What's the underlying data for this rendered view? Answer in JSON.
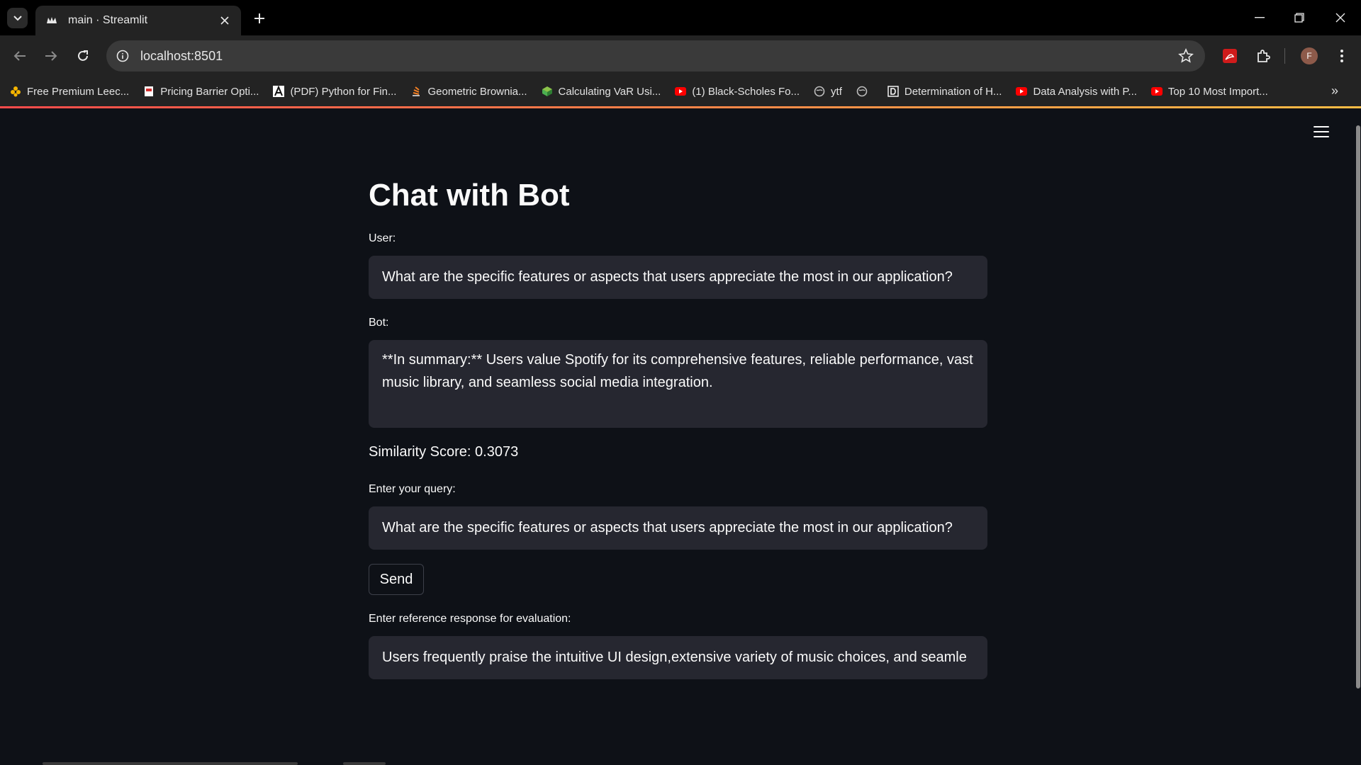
{
  "browser": {
    "tab_title": "main · Streamlit",
    "url": "localhost:8501",
    "avatar_letter": "F",
    "bookmarks": [
      {
        "label": "Free Premium Leec...",
        "icon": "flower-icon",
        "color": "#f4b400"
      },
      {
        "label": "Pricing Barrier Opti...",
        "icon": "document-icon",
        "color": "#d32f2f"
      },
      {
        "label": "(PDF) Python for Fin...",
        "icon": "academia-icon",
        "color": "#ffffff"
      },
      {
        "label": "Geometric Brownia...",
        "icon": "stack-icon",
        "color": "#f48024"
      },
      {
        "label": "Calculating VaR Usi...",
        "icon": "cube-icon",
        "color": "#4caf50"
      },
      {
        "label": "(1) Black-Scholes Fo...",
        "icon": "youtube-icon",
        "color": "#ff0000"
      },
      {
        "label": "ytf",
        "icon": "globe-icon",
        "color": "#bdbdbd"
      },
      {
        "label": "",
        "icon": "globe-icon",
        "color": "#bdbdbd"
      },
      {
        "label": "Determination of H...",
        "icon": "d-icon",
        "color": "#ffffff"
      },
      {
        "label": "Data Analysis with P...",
        "icon": "youtube-icon",
        "color": "#ff0000"
      },
      {
        "label": "Top 10 Most Import...",
        "icon": "youtube-icon",
        "color": "#ff0000"
      }
    ]
  },
  "app": {
    "title": "Chat with Bot",
    "user_label": "User:",
    "user_value": "What are the specific features or aspects that users appreciate the most in our application?",
    "bot_label": "Bot:",
    "bot_value": "**In summary:** Users value Spotify for its comprehensive features, reliable performance, vast music library, and seamless social media integration.",
    "similarity": "Similarity Score: 0.3073",
    "query_label": "Enter your query:",
    "query_value": "What are the specific features or aspects that users appreciate the most in our application?",
    "send_label": "Send",
    "reference_label": "Enter reference response for evaluation:",
    "reference_value": "Users frequently praise the intuitive UI design,extensive variety of music choices, and seamle"
  },
  "colors": {
    "background": "#0e1117",
    "input_bg": "#262730",
    "text": "#fafafa",
    "accent_gradient_start": "#ff4b4b",
    "accent_gradient_end": "#ffbd45"
  }
}
